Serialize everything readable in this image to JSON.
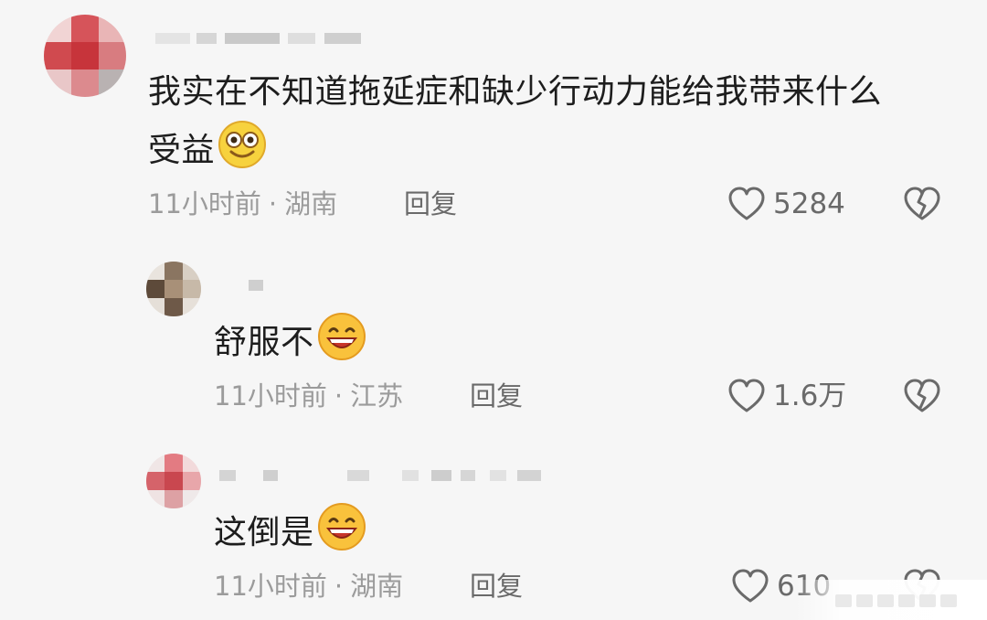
{
  "comments": [
    {
      "text": "我实在不知道拖延症和缺少行动力能给我带来什么",
      "text_line2": "受益",
      "emoji": "laughing-glasses-emoji",
      "time": "11小时前",
      "location": "湖南",
      "reply": "回复",
      "likes": "5284"
    },
    {
      "text": "舒服不",
      "emoji": "grinning-emoji",
      "time": "11小时前",
      "location": "江苏",
      "reply": "回复",
      "likes": "1.6万"
    },
    {
      "text": "这倒是",
      "emoji": "grinning-emoji",
      "time": "11小时前",
      "location": "湖南",
      "reply": "回复",
      "likes": "610"
    }
  ],
  "separator": "·",
  "colors": {
    "background": "#f6f6f6",
    "text": "#1d1d1d",
    "meta": "#9b9b9b",
    "action": "#6a6a6a"
  }
}
